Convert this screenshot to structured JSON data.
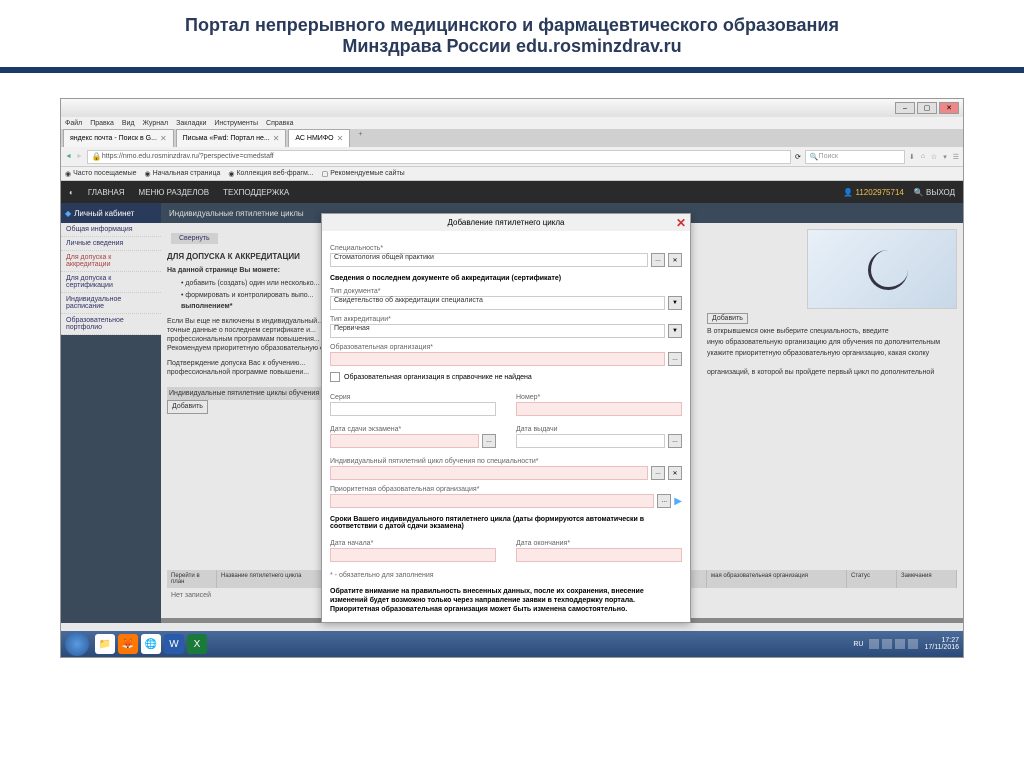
{
  "slide": {
    "title_line1": "Портал непрерывного медицинского и фармацевтического образования",
    "title_line2": "Минздрава России edu.rosminzdrav.ru"
  },
  "window": {
    "menu": [
      "Файл",
      "Правка",
      "Вид",
      "Журнал",
      "Закладки",
      "Инструменты",
      "Справка"
    ]
  },
  "tabs": [
    {
      "label": "яндекс почта - Поиск в G...",
      "active": false
    },
    {
      "label": "Письма «Fwd: Портал не...",
      "active": false
    },
    {
      "label": "АС НМИФО",
      "active": true
    }
  ],
  "addressbar": {
    "url": "https://nmo.edu.rosminzdrav.ru/?perspective=cmedstaff",
    "search_placeholder": "Поиск"
  },
  "bookmarks": [
    "Часто посещаемые",
    "Начальная страница",
    "Коллекция веб-фрагм...",
    "Рекомендуемые сайты"
  ],
  "app_nav": [
    "ГЛАВНАЯ",
    "МЕНЮ РАЗДЕЛОВ",
    "ТЕХПОДДЕРЖКА"
  ],
  "user": {
    "id": "11202975714",
    "logout": "ВЫХОД"
  },
  "cabinet": "Личный кабинет",
  "sidebar": [
    "Общая информация",
    "Личные сведения",
    "Для допуска к аккредитации",
    "Для допуска к сертификации",
    "Индивидуальное расписание",
    "Образовательное портфолио"
  ],
  "section": "Индивидуальные пятилетние циклы",
  "collapse": "Свернуть",
  "content": {
    "heading": "ДЛЯ ДОПУСКА К АККРЕДИТАЦИИ",
    "subheading": "На данной странице Вы можете:",
    "bullet1": "добавить (создать) один или несколько...",
    "bullet2": "формировать и контролировать выпо...",
    "bullet2b": "выполнением*",
    "para1": "Если Вы еще не включены в индивидуальный...",
    "para2": "точные данные о последнем сертификате и...",
    "para3": "профессиональным программам повышения...",
    "para4": "Рекомендуем приоритетную образовательную организ...",
    "confirm1": "Подтверждение допуска Вас к обучению...",
    "confirm2": "профессиональной программе повышени...",
    "table_heading": "Индивидуальные пятилетние циклы обучения по спе...",
    "add": "Добавить",
    "right_info1": "В открывшемся окне выберите специальность, введите",
    "right_info2": "иную образовательную организацию для обучения по дополнительным",
    "right_info3": "укажите приоритетную образовательную организацию, какая сколку",
    "right_info4": "организаций, в которой вы пройдете первый цикл по дополнительной"
  },
  "table_headers": [
    "Перейти в план",
    "Название пятилетнего цикла",
    "мая образовательная организация",
    "Статус",
    "Замечания"
  ],
  "no_records": "Нет записей",
  "modal": {
    "title": "Добавление пятилетнего цикла",
    "spec_label": "Специальность*",
    "spec_value": "Стоматология общей практики",
    "doc_section": "Сведения о последнем документе об аккредитации (сертификате)",
    "doc_type_label": "Тип документа*",
    "doc_type_value": "Свидетельство об аккредитации специалиста",
    "accred_type_label": "Тип аккредитации*",
    "accred_type_value": "Первичная",
    "org_label": "Образовательная организация*",
    "checkbox_label": "Образовательная организация в справочнике не найдена",
    "series_label": "Серия",
    "number_label": "Номер*",
    "exam_date_label": "Дата сдачи экзамена*",
    "issue_date_label": "Дата выдачи",
    "cycle_label": "Индивидуальный пятилетний цикл обучения по специальности*",
    "priority_org_label": "Приоритетная образовательная организация*",
    "terms_title": "Сроки Вашего индивидуального пятилетнего цикла (даты формируются автоматически в соответствии с датой сдачи экзамена)",
    "start_date_label": "Дата начала*",
    "end_date_label": "Дата окончания*",
    "required_note": "* - обязательно для заполнения",
    "note1": "Обратите внимание на правильность внесенных данных, после их сохранения, внесение изменений будет возможно только через направление заявки в техподдержку портала.",
    "note2": "Приоритетная образовательная организация может быть изменена самостоятельно."
  },
  "taskbar": {
    "time": "17:27",
    "date": "17/11/2016",
    "lang": "RU"
  }
}
